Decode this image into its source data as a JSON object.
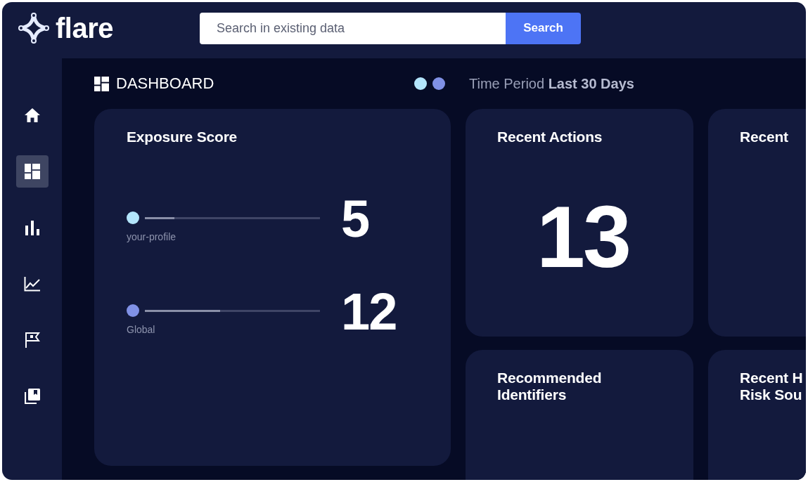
{
  "header": {
    "logo": "flare",
    "search": {
      "placeholder": "Search in existing data"
    },
    "search_button": "Search"
  },
  "sidebar": {
    "items": [
      {
        "kind": "home",
        "selected": false
      },
      {
        "kind": "dashboard",
        "selected": true
      },
      {
        "kind": "bars",
        "selected": false
      },
      {
        "kind": "line",
        "selected": false
      },
      {
        "kind": "flag",
        "selected": false
      },
      {
        "kind": "library",
        "selected": false
      }
    ]
  },
  "dashboard": {
    "title": "DASHBOARD",
    "legend": [
      {
        "color": "#b3e5fc"
      },
      {
        "color": "#8091e6"
      }
    ],
    "time_period": {
      "label": "Time Period",
      "value": "Last 30 Days"
    }
  },
  "cards": [
    {
      "kind": "exposure",
      "title": "Exposure Score",
      "rows": [
        {
          "label": "your-profile",
          "color": "#b3e5fc",
          "level": 0.17,
          "score": "5"
        },
        {
          "label": "Global",
          "color": "#8091e6",
          "level": 0.43,
          "score": "12"
        }
      ]
    },
    {
      "kind": "count",
      "title": "Recent Actions",
      "value": "13"
    },
    {
      "kind": "count",
      "title": "Recent"
    },
    {
      "kind": "count",
      "title": "Recommended Identifiers"
    },
    {
      "kind": "count",
      "title": "Recent H\nRisk Sou"
    }
  ]
}
